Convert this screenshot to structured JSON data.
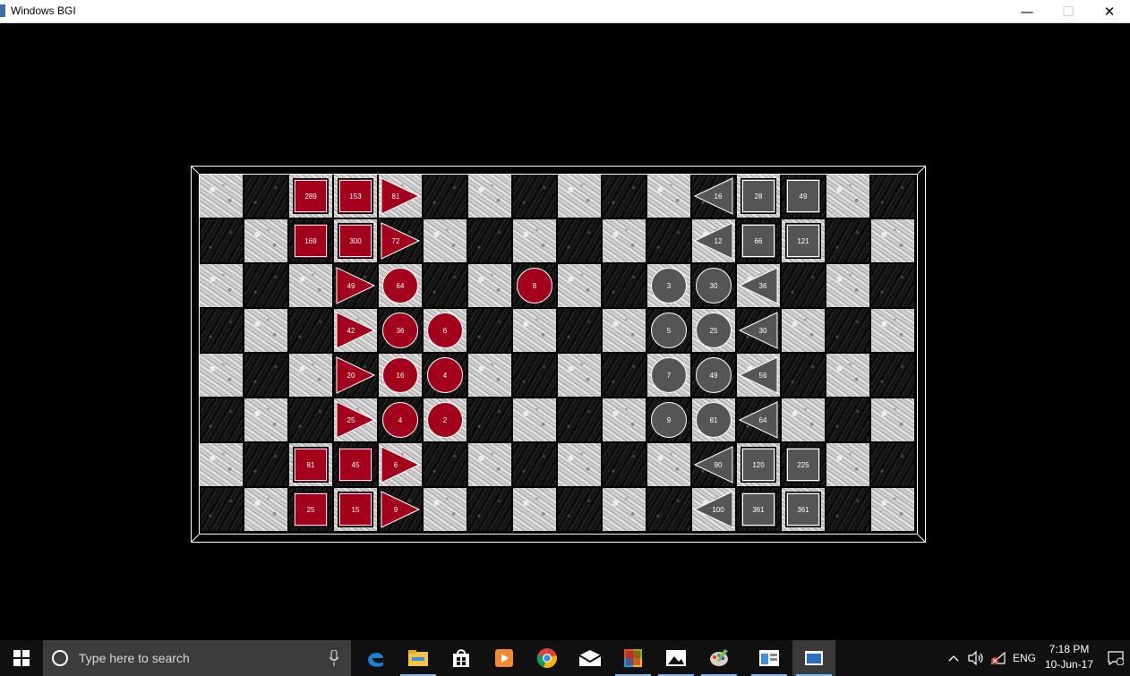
{
  "window": {
    "title": "Windows BGI"
  },
  "board": {
    "cols": 16,
    "rows": 8,
    "light_color": "#c8c8c8",
    "dark_color": "#141414",
    "red_color": "#a3001b",
    "gray_color": "#555555",
    "grid": [
      "LDLLLDLDLDLDLDLD",
      "DLDLDLDLDLDLDLDL",
      "LDLDLDLDLDLDLDLD",
      "DLDLDLDLDLDLDLDL",
      "LDLDLDLDLDLDLDLD",
      "DLDLDLDLDLDLDLDL",
      "LDLDLDLDLDLDLDLD",
      "DLDLDLDLDLDLDLDL"
    ],
    "pieces": [
      {
        "row": 0,
        "col": 2,
        "shape": "square",
        "color": "red",
        "value": "289"
      },
      {
        "row": 0,
        "col": 3,
        "shape": "square",
        "color": "red",
        "value": "153"
      },
      {
        "row": 0,
        "col": 4,
        "shape": "triangle-right",
        "color": "red",
        "value": "81"
      },
      {
        "row": 0,
        "col": 11,
        "shape": "triangle-left",
        "color": "gray",
        "value": "16"
      },
      {
        "row": 0,
        "col": 12,
        "shape": "square",
        "color": "gray",
        "value": "28"
      },
      {
        "row": 0,
        "col": 13,
        "shape": "square",
        "color": "gray",
        "value": "49"
      },
      {
        "row": 1,
        "col": 2,
        "shape": "square",
        "color": "red",
        "value": "169"
      },
      {
        "row": 1,
        "col": 3,
        "shape": "square",
        "color": "red",
        "value": "300"
      },
      {
        "row": 1,
        "col": 4,
        "shape": "triangle-right",
        "color": "red",
        "value": "72"
      },
      {
        "row": 1,
        "col": 11,
        "shape": "triangle-left",
        "color": "gray",
        "value": "12"
      },
      {
        "row": 1,
        "col": 12,
        "shape": "square",
        "color": "gray",
        "value": "66"
      },
      {
        "row": 1,
        "col": 13,
        "shape": "square",
        "color": "gray",
        "value": "121"
      },
      {
        "row": 2,
        "col": 3,
        "shape": "triangle-right",
        "color": "red",
        "value": "49"
      },
      {
        "row": 2,
        "col": 4,
        "shape": "circle",
        "color": "red",
        "value": "64"
      },
      {
        "row": 2,
        "col": 7,
        "shape": "circle",
        "color": "red",
        "value": "8"
      },
      {
        "row": 2,
        "col": 10,
        "shape": "circle",
        "color": "gray",
        "value": "3"
      },
      {
        "row": 2,
        "col": 11,
        "shape": "circle",
        "color": "gray",
        "value": "30"
      },
      {
        "row": 2,
        "col": 12,
        "shape": "triangle-left",
        "color": "gray",
        "value": "36"
      },
      {
        "row": 3,
        "col": 3,
        "shape": "triangle-right",
        "color": "red",
        "value": "42"
      },
      {
        "row": 3,
        "col": 4,
        "shape": "circle",
        "color": "red",
        "value": "36"
      },
      {
        "row": 3,
        "col": 5,
        "shape": "circle",
        "color": "red",
        "value": "6"
      },
      {
        "row": 3,
        "col": 10,
        "shape": "circle",
        "color": "gray",
        "value": "5"
      },
      {
        "row": 3,
        "col": 11,
        "shape": "circle",
        "color": "gray",
        "value": "25"
      },
      {
        "row": 3,
        "col": 12,
        "shape": "triangle-left",
        "color": "gray",
        "value": "30"
      },
      {
        "row": 4,
        "col": 3,
        "shape": "triangle-right",
        "color": "red",
        "value": "20"
      },
      {
        "row": 4,
        "col": 4,
        "shape": "circle",
        "color": "red",
        "value": "16"
      },
      {
        "row": 4,
        "col": 5,
        "shape": "circle",
        "color": "red",
        "value": "4"
      },
      {
        "row": 4,
        "col": 10,
        "shape": "circle",
        "color": "gray",
        "value": "7"
      },
      {
        "row": 4,
        "col": 11,
        "shape": "circle",
        "color": "gray",
        "value": "49"
      },
      {
        "row": 4,
        "col": 12,
        "shape": "triangle-left",
        "color": "gray",
        "value": "56"
      },
      {
        "row": 5,
        "col": 3,
        "shape": "triangle-right",
        "color": "red",
        "value": "25"
      },
      {
        "row": 5,
        "col": 4,
        "shape": "circle",
        "color": "red",
        "value": "4"
      },
      {
        "row": 5,
        "col": 5,
        "shape": "circle",
        "color": "red",
        "value": "2"
      },
      {
        "row": 5,
        "col": 10,
        "shape": "circle",
        "color": "gray",
        "value": "9"
      },
      {
        "row": 5,
        "col": 11,
        "shape": "circle",
        "color": "gray",
        "value": "81"
      },
      {
        "row": 5,
        "col": 12,
        "shape": "triangle-left",
        "color": "gray",
        "value": "64"
      },
      {
        "row": 6,
        "col": 2,
        "shape": "square",
        "color": "red",
        "value": "81"
      },
      {
        "row": 6,
        "col": 3,
        "shape": "square",
        "color": "red",
        "value": "45"
      },
      {
        "row": 6,
        "col": 4,
        "shape": "triangle-right",
        "color": "red",
        "value": "6"
      },
      {
        "row": 6,
        "col": 11,
        "shape": "triangle-left",
        "color": "gray",
        "value": "90"
      },
      {
        "row": 6,
        "col": 12,
        "shape": "square",
        "color": "gray",
        "value": "120"
      },
      {
        "row": 6,
        "col": 13,
        "shape": "square",
        "color": "gray",
        "value": "225"
      },
      {
        "row": 7,
        "col": 2,
        "shape": "square",
        "color": "red",
        "value": "25"
      },
      {
        "row": 7,
        "col": 3,
        "shape": "square",
        "color": "red",
        "value": "15"
      },
      {
        "row": 7,
        "col": 4,
        "shape": "triangle-right",
        "color": "red",
        "value": "9"
      },
      {
        "row": 7,
        "col": 11,
        "shape": "triangle-left",
        "color": "gray",
        "value": "100"
      },
      {
        "row": 7,
        "col": 12,
        "shape": "square",
        "color": "gray",
        "value": "361"
      },
      {
        "row": 7,
        "col": 13,
        "shape": "square",
        "color": "gray",
        "value": "361"
      }
    ]
  },
  "taskbar": {
    "search_placeholder": "Type here to search",
    "apps": [
      "edge-icon",
      "file-explorer-icon",
      "store-icon",
      "media-player-icon",
      "chrome-icon",
      "mail-icon",
      "office-icon",
      "photos-icon",
      "paint-icon",
      "app-window-icon",
      "bgi-window-icon"
    ],
    "language": "ENG",
    "time": "7:18 PM",
    "date": "10-Jun-17"
  }
}
